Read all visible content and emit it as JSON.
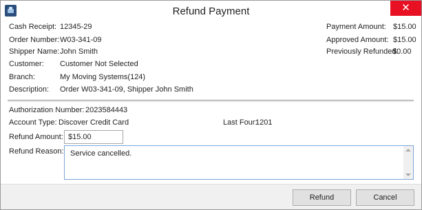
{
  "window": {
    "title": "Refund Payment",
    "close_glyph": "✕",
    "icon": "app-logo-icon"
  },
  "details": {
    "cash_receipt_label": "Cash Receipt:",
    "cash_receipt_value": "12345-29",
    "order_number_label": "Order Number:",
    "order_number_value": "W03-341-09",
    "shipper_name_label": "Shipper Name:",
    "shipper_name_value": "John Smith",
    "customer_label": "Customer:",
    "customer_value": "Customer Not Selected",
    "branch_label": "Branch:",
    "branch_value": "My Moving Systems(124)",
    "description_label": "Description:",
    "description_value": "Order W03-341-09, Shipper John Smith"
  },
  "amounts": {
    "payment_amount_label": "Payment Amount:",
    "payment_amount_value": "$15.00",
    "approved_amount_label": "Approved Amount:",
    "approved_amount_value": "$15.00",
    "previously_refunded_label": "Previously Refunded:",
    "previously_refunded_value": "$0.00"
  },
  "authorization": {
    "authorization_number_label": "Authorization Number:",
    "authorization_number_value": "2023584443",
    "account_type_label": "Account Type:",
    "account_type_value": "Discover Credit Card",
    "last_four_label": "Last Four:",
    "last_four_value": "1201"
  },
  "refund": {
    "amount_label": "Refund Amount:",
    "amount_value": "$15.00",
    "reason_label": "Refund Reason:",
    "reason_value": "Service cancelled."
  },
  "buttons": {
    "refund_label": "Refund",
    "cancel_label": "Cancel"
  },
  "colors": {
    "close_button": "#e81123",
    "footer": "#f0f0f0",
    "focus_border": "#7aa7d8"
  }
}
